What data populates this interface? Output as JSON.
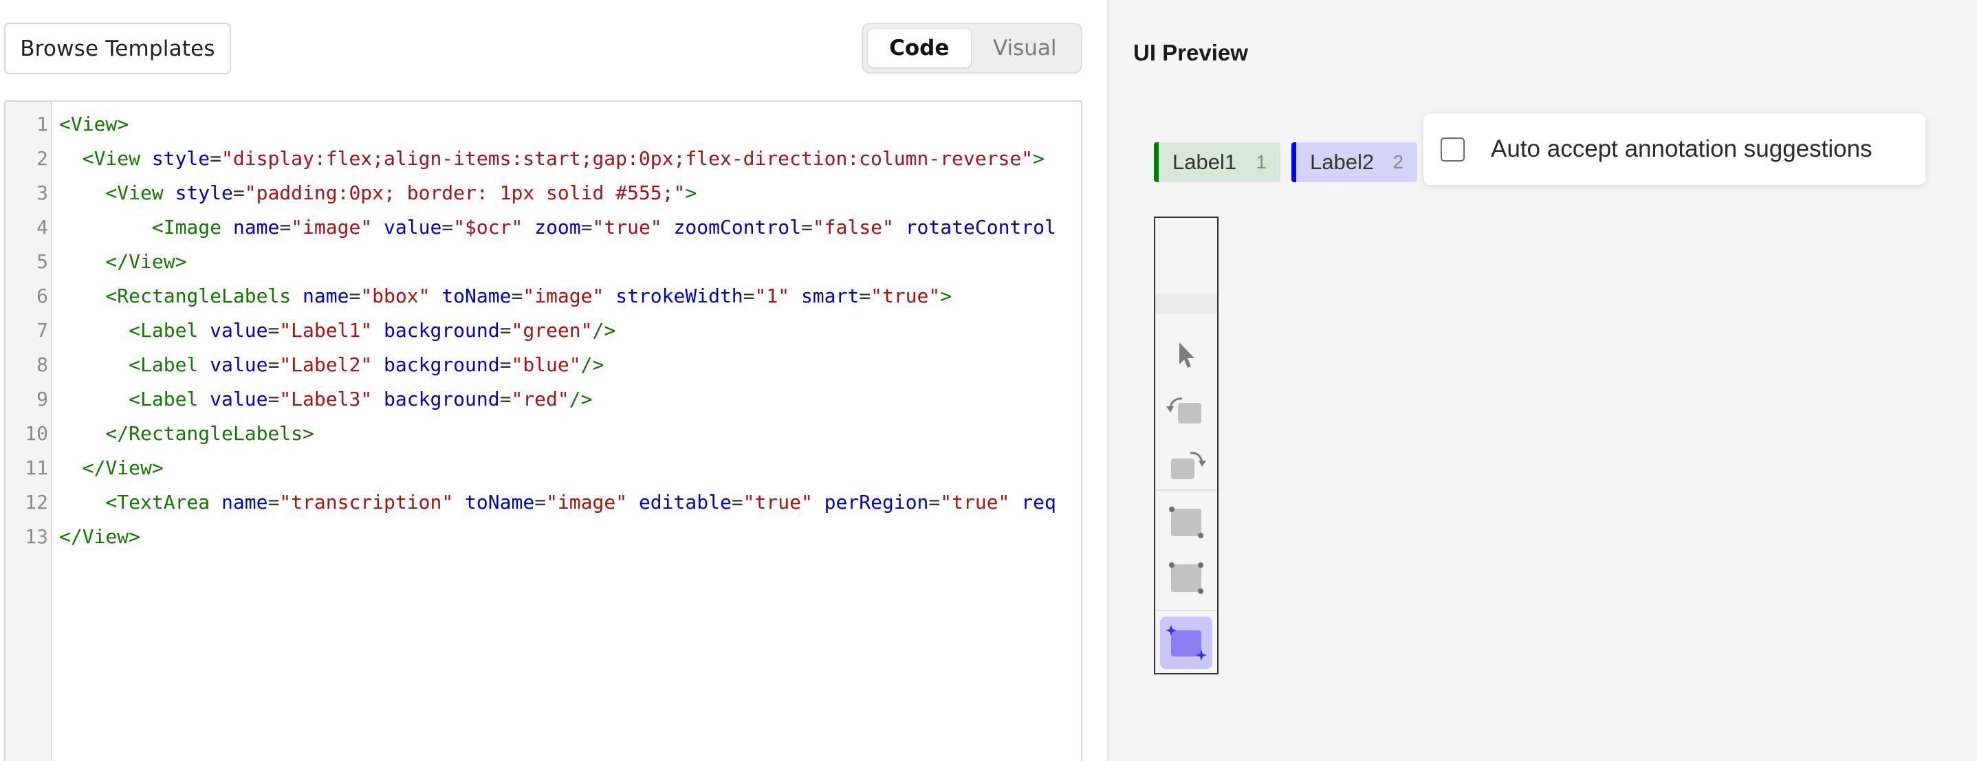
{
  "toolbar": {
    "browse_label": "Browse Templates",
    "mode_tabs": [
      {
        "label": "Code",
        "active": true
      },
      {
        "label": "Visual",
        "active": false
      }
    ]
  },
  "editor": {
    "lines": [
      {
        "num": "1",
        "tokens": [
          {
            "t": "tag",
            "v": "<View>"
          }
        ]
      },
      {
        "num": "2",
        "tokens": [
          {
            "t": "tag",
            "v": "  <View "
          },
          {
            "t": "attr",
            "v": "style"
          },
          {
            "t": "pun",
            "v": "="
          },
          {
            "t": "str",
            "v": "\"display:flex;align-items:start;gap:0px;flex-direction:column-reverse\""
          },
          {
            "t": "tag",
            "v": ">"
          }
        ]
      },
      {
        "num": "3",
        "tokens": [
          {
            "t": "tag",
            "v": "    <View "
          },
          {
            "t": "attr",
            "v": "style"
          },
          {
            "t": "pun",
            "v": "="
          },
          {
            "t": "str",
            "v": "\"padding:0px; border: 1px solid #555;\""
          },
          {
            "t": "tag",
            "v": ">"
          }
        ]
      },
      {
        "num": "4",
        "tokens": [
          {
            "t": "tag",
            "v": "        <Image "
          },
          {
            "t": "attr",
            "v": "name"
          },
          {
            "t": "pun",
            "v": "="
          },
          {
            "t": "str",
            "v": "\"image\""
          },
          {
            "t": "pun",
            "v": " "
          },
          {
            "t": "attr",
            "v": "value"
          },
          {
            "t": "pun",
            "v": "="
          },
          {
            "t": "str",
            "v": "\"$ocr\""
          },
          {
            "t": "pun",
            "v": " "
          },
          {
            "t": "attr",
            "v": "zoom"
          },
          {
            "t": "pun",
            "v": "="
          },
          {
            "t": "str",
            "v": "\"true\""
          },
          {
            "t": "pun",
            "v": " "
          },
          {
            "t": "attr",
            "v": "zoomControl"
          },
          {
            "t": "pun",
            "v": "="
          },
          {
            "t": "str",
            "v": "\"false\""
          },
          {
            "t": "pun",
            "v": " "
          },
          {
            "t": "attr",
            "v": "rotateControl"
          }
        ]
      },
      {
        "num": "5",
        "tokens": [
          {
            "t": "tag",
            "v": "    </View>"
          }
        ]
      },
      {
        "num": "6",
        "tokens": [
          {
            "t": "tag",
            "v": "    <RectangleLabels "
          },
          {
            "t": "attr",
            "v": "name"
          },
          {
            "t": "pun",
            "v": "="
          },
          {
            "t": "str",
            "v": "\"bbox\""
          },
          {
            "t": "pun",
            "v": " "
          },
          {
            "t": "attr",
            "v": "toName"
          },
          {
            "t": "pun",
            "v": "="
          },
          {
            "t": "str",
            "v": "\"image\""
          },
          {
            "t": "pun",
            "v": " "
          },
          {
            "t": "attr",
            "v": "strokeWidth"
          },
          {
            "t": "pun",
            "v": "="
          },
          {
            "t": "str",
            "v": "\"1\""
          },
          {
            "t": "pun",
            "v": " "
          },
          {
            "t": "attr",
            "v": "smart"
          },
          {
            "t": "pun",
            "v": "="
          },
          {
            "t": "str",
            "v": "\"true\""
          },
          {
            "t": "tag",
            "v": ">"
          }
        ]
      },
      {
        "num": "7",
        "tokens": [
          {
            "t": "tag",
            "v": "      <Label "
          },
          {
            "t": "attr",
            "v": "value"
          },
          {
            "t": "pun",
            "v": "="
          },
          {
            "t": "str",
            "v": "\"Label1\""
          },
          {
            "t": "pun",
            "v": " "
          },
          {
            "t": "attr",
            "v": "background"
          },
          {
            "t": "pun",
            "v": "="
          },
          {
            "t": "str",
            "v": "\"green\""
          },
          {
            "t": "tag",
            "v": "/>"
          }
        ]
      },
      {
        "num": "8",
        "tokens": [
          {
            "t": "tag",
            "v": "      <Label "
          },
          {
            "t": "attr",
            "v": "value"
          },
          {
            "t": "pun",
            "v": "="
          },
          {
            "t": "str",
            "v": "\"Label2\""
          },
          {
            "t": "pun",
            "v": " "
          },
          {
            "t": "attr",
            "v": "background"
          },
          {
            "t": "pun",
            "v": "="
          },
          {
            "t": "str",
            "v": "\"blue\""
          },
          {
            "t": "tag",
            "v": "/>"
          }
        ]
      },
      {
        "num": "9",
        "tokens": [
          {
            "t": "tag",
            "v": "      <Label "
          },
          {
            "t": "attr",
            "v": "value"
          },
          {
            "t": "pun",
            "v": "="
          },
          {
            "t": "str",
            "v": "\"Label3\""
          },
          {
            "t": "pun",
            "v": " "
          },
          {
            "t": "attr",
            "v": "background"
          },
          {
            "t": "pun",
            "v": "="
          },
          {
            "t": "str",
            "v": "\"red\""
          },
          {
            "t": "tag",
            "v": "/>"
          }
        ]
      },
      {
        "num": "10",
        "tokens": [
          {
            "t": "tag",
            "v": "    </RectangleLabels>"
          }
        ]
      },
      {
        "num": "11",
        "tokens": [
          {
            "t": "tag",
            "v": "  </View>"
          }
        ]
      },
      {
        "num": "12",
        "tokens": [
          {
            "t": "tag",
            "v": "    <TextArea "
          },
          {
            "t": "attr",
            "v": "name"
          },
          {
            "t": "pun",
            "v": "="
          },
          {
            "t": "str",
            "v": "\"transcription\""
          },
          {
            "t": "pun",
            "v": " "
          },
          {
            "t": "attr",
            "v": "toName"
          },
          {
            "t": "pun",
            "v": "="
          },
          {
            "t": "str",
            "v": "\"image\""
          },
          {
            "t": "pun",
            "v": " "
          },
          {
            "t": "attr",
            "v": "editable"
          },
          {
            "t": "pun",
            "v": "="
          },
          {
            "t": "str",
            "v": "\"true\""
          },
          {
            "t": "pun",
            "v": " "
          },
          {
            "t": "attr",
            "v": "perRegion"
          },
          {
            "t": "pun",
            "v": "="
          },
          {
            "t": "str",
            "v": "\"true\""
          },
          {
            "t": "pun",
            "v": " "
          },
          {
            "t": "attr",
            "v": "req"
          }
        ]
      },
      {
        "num": "13",
        "tokens": [
          {
            "t": "tag",
            "v": "</View>"
          }
        ]
      }
    ]
  },
  "preview": {
    "title": "UI Preview",
    "labels": [
      {
        "name": "Label1",
        "hotkey": "1",
        "color": "#008000"
      },
      {
        "name": "Label2",
        "hotkey": "2",
        "color": "#0000ff"
      }
    ],
    "auto_accept": {
      "label": "Auto accept annotation suggestions",
      "checked": false
    },
    "tools": [
      {
        "icon": "pointer-icon"
      },
      {
        "icon": "rotate-left-icon"
      },
      {
        "icon": "rotate-right-icon"
      },
      {
        "icon": "rectangle-two-point-icon"
      },
      {
        "icon": "rectangle-three-point-icon"
      },
      {
        "icon": "smart-rectangle-icon",
        "active": true
      }
    ]
  }
}
